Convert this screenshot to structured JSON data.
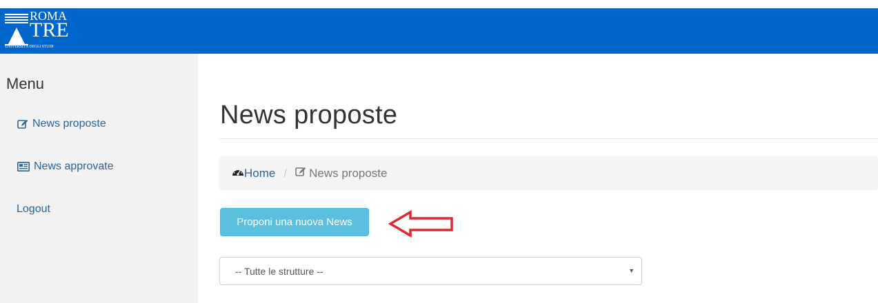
{
  "header": {
    "logo_top": "ROMA",
    "logo_main": "TRE",
    "logo_sub": "UNIVERSITÀ DEGLI STUDI",
    "background_color": "#0066cc"
  },
  "sidebar": {
    "title": "Menu",
    "items": [
      {
        "label": "News proposte",
        "icon": "edit-icon"
      },
      {
        "label": "News approvate",
        "icon": "newspaper-icon"
      },
      {
        "label": "Logout",
        "icon": ""
      }
    ]
  },
  "main": {
    "title": "News proposte",
    "breadcrumb": {
      "home": "Home",
      "separator": "/",
      "current": "News proposte"
    },
    "new_button_label": "Proponi una nuova News",
    "structure_select": {
      "selected": "-- Tutte le strutture --"
    }
  },
  "colors": {
    "link": "#2a6496",
    "info_button": "#5bc0de",
    "annotation_arrow": "#e0282e"
  }
}
